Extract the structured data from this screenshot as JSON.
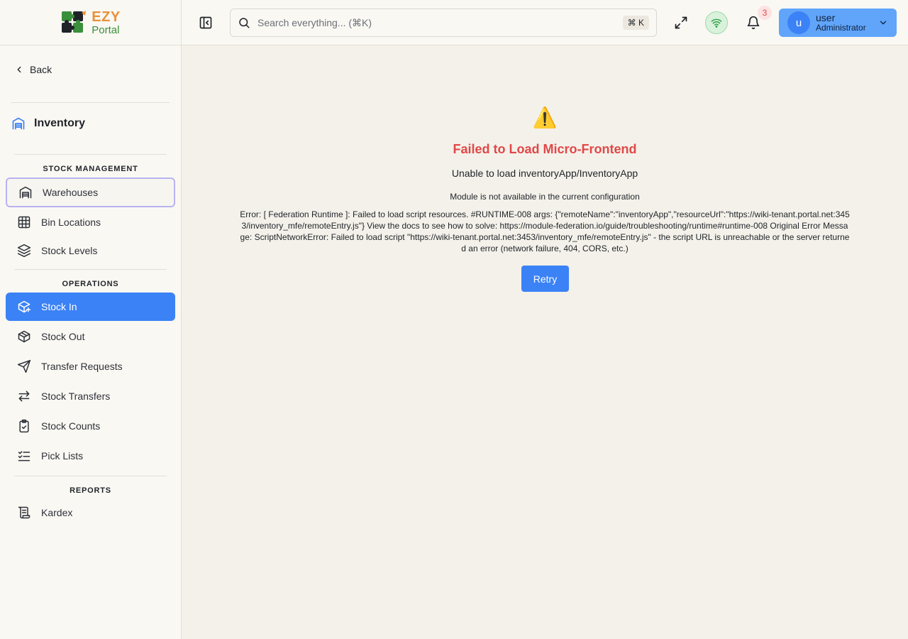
{
  "brand": {
    "line1": "EZY",
    "line2": "Portal"
  },
  "sidebar": {
    "back_label": "Back",
    "module_title": "Inventory",
    "sections": [
      {
        "label": "STOCK MANAGEMENT",
        "items": [
          {
            "label": "Warehouses",
            "icon": "warehouse-icon",
            "state": "focused"
          },
          {
            "label": "Bin Locations",
            "icon": "grid-icon"
          },
          {
            "label": "Stock Levels",
            "icon": "layers-icon"
          }
        ]
      },
      {
        "label": "OPERATIONS",
        "items": [
          {
            "label": "Stock In",
            "icon": "package-plus-icon",
            "state": "active"
          },
          {
            "label": "Stock Out",
            "icon": "package-icon"
          },
          {
            "label": "Transfer Requests",
            "icon": "send-icon"
          },
          {
            "label": "Stock Transfers",
            "icon": "arrows-left-right-icon"
          },
          {
            "label": "Stock Counts",
            "icon": "clipboard-check-icon"
          },
          {
            "label": "Pick Lists",
            "icon": "list-checks-icon"
          }
        ]
      },
      {
        "label": "REPORTS",
        "items": [
          {
            "label": "Kardex",
            "icon": "scroll-icon"
          }
        ]
      }
    ]
  },
  "header": {
    "search_placeholder": "Search everything... (⌘K)",
    "shortcut": "⌘ K",
    "notification_count": "3",
    "user": {
      "initial": "u",
      "name": "user",
      "role": "Administrator"
    }
  },
  "colors": {
    "accent": "#3b82f6",
    "error": "#e04848",
    "brand_orange": "#e8913a",
    "brand_green": "#3a8f3a"
  },
  "error": {
    "icon": "⚠️",
    "title": "Failed to Load Micro-Frontend",
    "subtitle": "Unable to load inventoryApp/InventoryApp",
    "module_message": "Module is not available in the current configuration",
    "detail": "Error: [ Federation Runtime ]: Failed to load script resources. #RUNTIME-008 args: {\"remoteName\":\"inventoryApp\",\"resourceUrl\":\"https://wiki-tenant.portal.net:3453/inventory_mfe/remoteEntry.js\"} View the docs to see how to solve: https://module-federation.io/guide/troubleshooting/runtime#runtime-008 Original Error Message: ScriptNetworkError: Failed to load script \"https://wiki-tenant.portal.net:3453/inventory_mfe/remoteEntry.js\" - the script URL is unreachable or the server returned an error (network failure, 404, CORS, etc.)",
    "retry_label": "Retry"
  }
}
